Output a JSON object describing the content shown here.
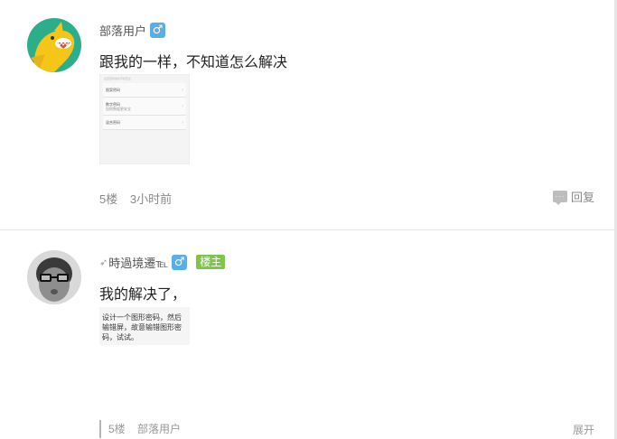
{
  "posts": [
    {
      "author": "部落用户",
      "gender_icon": "male-icon",
      "content": "跟我的一样，不知道怎么解决",
      "floor": "5楼",
      "time": "3小时前",
      "reply_label": "回复",
      "screenshot": {
        "hint": "设置密码保护手机安全",
        "rows": [
          {
            "label": "图案密码"
          },
          {
            "label": "数字密码",
            "sub": "加密数据更安全"
          },
          {
            "label": "混合密码"
          }
        ]
      }
    },
    {
      "author_prefix_icon": "feather-icon",
      "author": "時過境遷℡",
      "gender_icon": "male-icon",
      "badge": "楼主",
      "content": "我的解决了，",
      "image_text": "设计一个图形密码，然后输错屏，故意输错图形密码，试试。",
      "sub_floor": "5楼",
      "sub_author": "部落用户",
      "expand_label": "展开"
    }
  ],
  "colors": {
    "gender_badge": "#5aaee6",
    "host_badge": "#7fc54b"
  }
}
